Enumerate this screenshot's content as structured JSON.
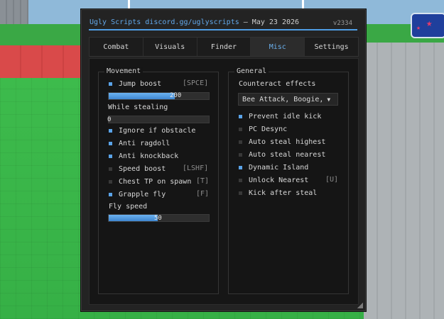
{
  "window": {
    "title_app": "Ugly Scripts",
    "title_link": "discord.gg/uglyscripts",
    "title_sep": " — ",
    "title_date": "May 23 2026",
    "version": "v2334"
  },
  "tabs": [
    {
      "label": "Combat"
    },
    {
      "label": "Visuals"
    },
    {
      "label": "Finder"
    },
    {
      "label": "Misc",
      "active": true
    },
    {
      "label": "Settings"
    }
  ],
  "movement": {
    "title": "Movement",
    "jump_boost": {
      "label": "Jump boost",
      "key": "[SPCE]",
      "enabled": true
    },
    "jump_slider": {
      "value": "200",
      "fill_percent": 66
    },
    "while_stealing": {
      "label": "While stealing"
    },
    "stealing_slider": {
      "value": "0",
      "fill_percent": 0
    },
    "ignore_if_obstacle": {
      "label": "Ignore if obstacle",
      "enabled": true
    },
    "anti_ragdoll": {
      "label": "Anti ragdoll",
      "enabled": true
    },
    "anti_knockback": {
      "label": "Anti knockback",
      "enabled": true
    },
    "speed_boost": {
      "label": "Speed boost",
      "key": "[LSHF]",
      "enabled": false
    },
    "chest_tp": {
      "label": "Chest TP on spawn",
      "key": "[T]",
      "enabled": false
    },
    "grapple_fly": {
      "label": "Grapple fly",
      "key": "[F]",
      "enabled": true
    },
    "fly_speed": {
      "label": "Fly speed"
    },
    "fly_slider": {
      "value": "50",
      "fill_percent": 49
    }
  },
  "general": {
    "title": "General",
    "counteract_label": "Counteract effects",
    "counteract_dropdown": {
      "value": "Bee Attack, Boogie,",
      "arrow": "▼"
    },
    "prevent_idle_kick": {
      "label": "Prevent idle kick",
      "enabled": true
    },
    "pc_desync": {
      "label": "PC Desync",
      "enabled": false
    },
    "auto_steal_highest": {
      "label": "Auto steal highest",
      "enabled": false
    },
    "auto_steal_nearest": {
      "label": "Auto steal nearest",
      "enabled": false
    },
    "dynamic_island": {
      "label": "Dynamic Island",
      "enabled": true
    },
    "unlock_nearest": {
      "label": "Unlock Nearest",
      "key": "[U]",
      "enabled": false
    },
    "kick_after_steal": {
      "label": "Kick after steal",
      "enabled": false
    }
  },
  "colors": {
    "accent": "#4f9ee6",
    "checkbox_on": "#5aa3e8",
    "checkbox_off": "#383838",
    "window_bg": "#232323"
  }
}
